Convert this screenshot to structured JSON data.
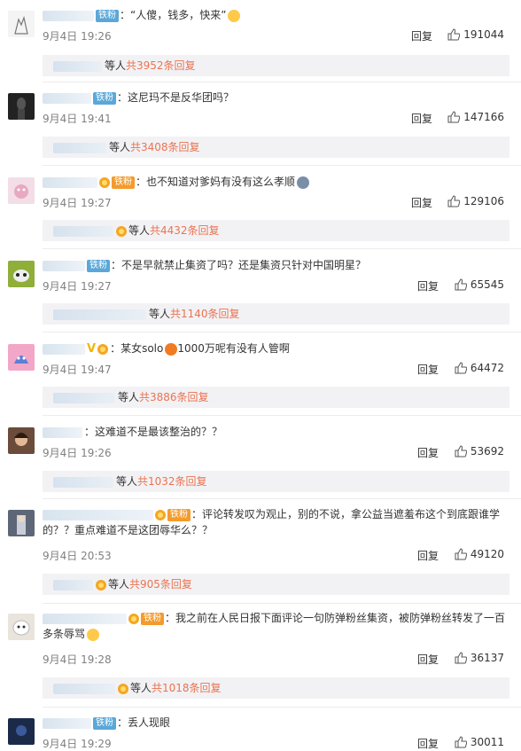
{
  "comments": [
    {
      "badge": "铁粉",
      "text": "：“人傻，钱多，快来”",
      "time": "9月4日 19:26",
      "reply": "回复",
      "likes": "191044",
      "others": "等人",
      "total": "共3952条回复"
    },
    {
      "badge": "铁粉",
      "text": "：这尼玛不是反华团吗？",
      "time": "9月4日 19:41",
      "reply": "回复",
      "likes": "147166",
      "others": "等人",
      "total": "共3408条回复"
    },
    {
      "badge": "铁粉",
      "text": "：也不知道对爹妈有没有这么孝顺",
      "time": "9月4日 19:27",
      "reply": "回复",
      "likes": "129106",
      "others": "等人",
      "total": "共4432条回复"
    },
    {
      "badge": "铁粉",
      "text": "：不是早就禁止集资了吗？还是集资只针对中国明星？",
      "time": "9月4日 19:27",
      "reply": "回复",
      "likes": "65545",
      "others": "等人",
      "total": "共1140条回复"
    },
    {
      "badge": "",
      "text": "：某女solo",
      "text2": "1000万呢有没有人管啊",
      "time": "9月4日 19:47",
      "reply": "回复",
      "likes": "64472",
      "others": "等人",
      "total": "共3886条回复"
    },
    {
      "badge": "",
      "text": "：这难道不是最该整治的？？",
      "time": "9月4日 19:26",
      "reply": "回复",
      "likes": "53692",
      "others": "等人",
      "total": "共1032条回复"
    },
    {
      "badge": "铁粉",
      "text": "：评论转发叹为观止，别的不说，拿公益当遮羞布这个到底跟谁学的？？重点难道不是这团辱华么？？",
      "time": "9月4日 20:53",
      "reply": "回复",
      "likes": "49120",
      "others": "等人",
      "total": "共905条回复"
    },
    {
      "badge": "铁粉",
      "text": "：我之前在人民日报下面评论一句防弹粉丝集资，被防弹粉丝转发了一百多条辱骂",
      "time": "9月4日 19:28",
      "reply": "回复",
      "likes": "36137",
      "others": "等人",
      "total": "共1018条回复"
    },
    {
      "badge": "铁粉",
      "text": "：丢人现眼",
      "time": "9月4日 19:29",
      "reply": "回复",
      "likes": "30011",
      "others": "",
      "total": ""
    }
  ]
}
